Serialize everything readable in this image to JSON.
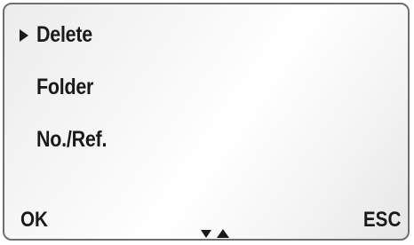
{
  "menu": {
    "selected_index": 0,
    "items": [
      {
        "label": "Delete"
      },
      {
        "label": "Folder"
      },
      {
        "label": "No./Ref."
      }
    ]
  },
  "softkeys": {
    "left_label": "OK",
    "right_label": "ESC"
  },
  "icons": {
    "cursor": "triangle-right-icon",
    "scroll_down": "triangle-down-icon",
    "scroll_up": "triangle-up-icon"
  },
  "colors": {
    "text": "#1a1a1a",
    "border": "#6f6f6f",
    "background": "#f6f6f6"
  }
}
